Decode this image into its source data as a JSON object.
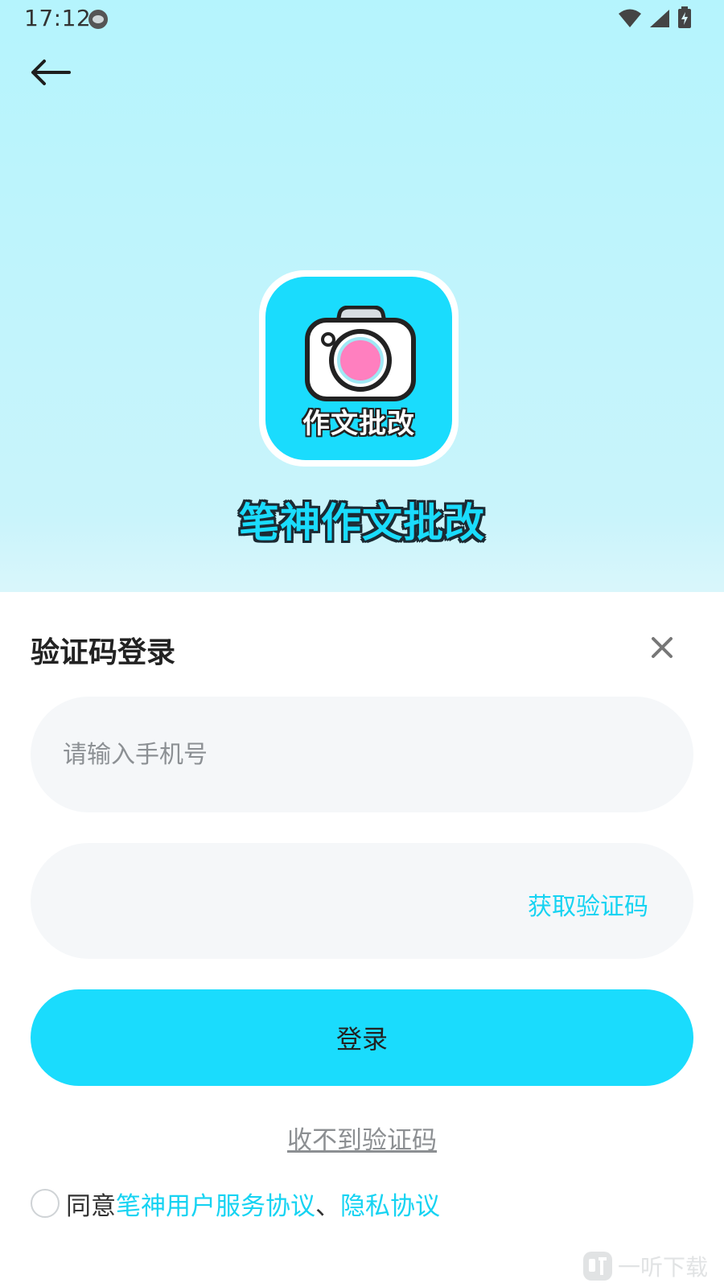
{
  "status_bar": {
    "time": "17:12"
  },
  "logo": {
    "caption": "作文批改"
  },
  "app_title": "笔神作文批改",
  "login_sheet": {
    "title": "验证码登录",
    "phone_placeholder": "请输入手机号",
    "code_placeholder": "",
    "get_code_label": "获取验证码",
    "login_label": "登录",
    "no_code_label": "收不到验证码",
    "agreement": {
      "prefix": "同意",
      "service_link": "笔神用户服务协议",
      "separator": "、",
      "privacy_link": "隐私协议"
    }
  },
  "watermark": {
    "text": "一听下载"
  },
  "colors": {
    "accent": "#1adcfd",
    "link": "#16d3f2",
    "field_bg": "#f5f7f9",
    "header_gradient_top": "#b5f4fd"
  },
  "icons": {
    "back": "arrow-left-icon",
    "close": "close-icon",
    "wifi": "wifi-icon",
    "signal": "signal-icon",
    "battery": "battery-charging-icon",
    "camera": "camera-icon"
  }
}
